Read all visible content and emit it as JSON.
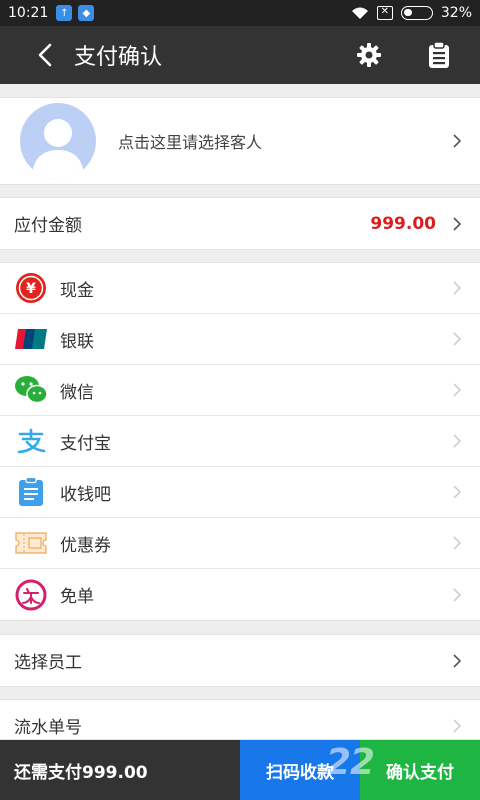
{
  "status_bar": {
    "time": "10:21",
    "battery": "32%",
    "battery_level": 0.32
  },
  "app_bar": {
    "title": "支付确认"
  },
  "customer": {
    "prompt": "点击这里请选择客人"
  },
  "amount_due": {
    "label": "应付金额",
    "value": "999.00"
  },
  "payment_methods": [
    {
      "label": "现金",
      "icon": "cash-yuan-icon"
    },
    {
      "label": "银联",
      "icon": "unionpay-icon"
    },
    {
      "label": "微信",
      "icon": "wechat-icon"
    },
    {
      "label": "支付宝",
      "icon": "alipay-icon"
    },
    {
      "label": "收钱吧",
      "icon": "shouqianba-icon"
    },
    {
      "label": "优惠券",
      "icon": "coupon-icon"
    },
    {
      "label": "免单",
      "icon": "free-order-icon"
    }
  ],
  "staff": {
    "label": "选择员工"
  },
  "serial": {
    "label": "流水单号"
  },
  "bottom": {
    "remaining": "还需支付999.00",
    "scan_label": "扫码收款",
    "confirm_label": "确认支付"
  },
  "colors": {
    "accent_red": "#d81e1e",
    "scan_blue": "#1877e9",
    "confirm_green": "#1fb542",
    "dark_bar": "#333333"
  }
}
